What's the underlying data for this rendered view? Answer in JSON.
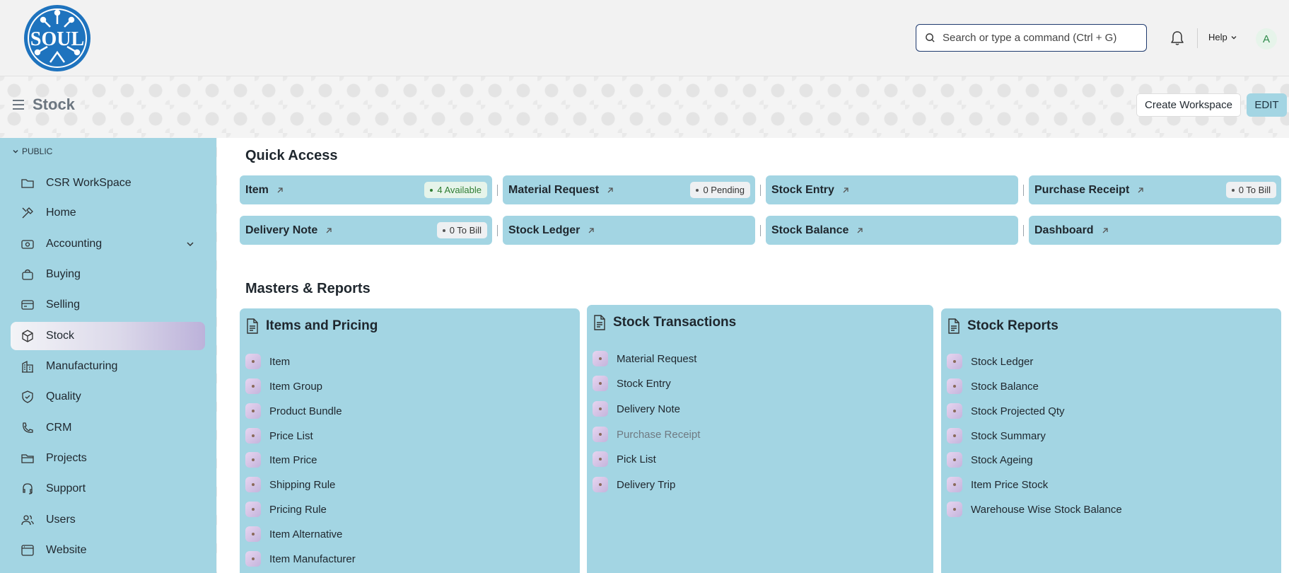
{
  "app": {
    "logo_text": "SOUL"
  },
  "topbar": {
    "search_placeholder": "Search or type a command (Ctrl + G)",
    "help_label": "Help",
    "avatar_initial": "A"
  },
  "page": {
    "title": "Stock",
    "create_workspace_label": "Create Workspace",
    "edit_label": "EDIT"
  },
  "sidebar": {
    "section_label": "PUBLIC",
    "items": [
      {
        "label": "CSR WorkSpace",
        "icon": "folder-icon"
      },
      {
        "label": "Home",
        "icon": "tools-icon"
      },
      {
        "label": "Accounting",
        "icon": "money-icon"
      },
      {
        "label": "Buying",
        "icon": "bag-icon"
      },
      {
        "label": "Selling",
        "icon": "card-icon"
      },
      {
        "label": "Stock",
        "icon": "box-icon"
      },
      {
        "label": "Manufacturing",
        "icon": "building-icon"
      },
      {
        "label": "Quality",
        "icon": "shield-icon"
      },
      {
        "label": "CRM",
        "icon": "phone-icon"
      },
      {
        "label": "Projects",
        "icon": "folder-icon"
      },
      {
        "label": "Support",
        "icon": "headset-icon"
      },
      {
        "label": "Users",
        "icon": "users-icon"
      },
      {
        "label": "Website",
        "icon": "browser-icon"
      }
    ]
  },
  "quick_access": {
    "heading": "Quick Access",
    "cards": [
      {
        "label": "Item",
        "badge": "4 Available"
      },
      {
        "label": "Material Request",
        "badge": "0 Pending"
      },
      {
        "label": "Stock Entry",
        "badge": ""
      },
      {
        "label": "Purchase Receipt",
        "badge": "0 To Bill"
      },
      {
        "label": "Delivery Note",
        "badge": "0 To Bill"
      },
      {
        "label": "Stock Ledger",
        "badge": ""
      },
      {
        "label": "Stock Balance",
        "badge": ""
      },
      {
        "label": "Dashboard",
        "badge": ""
      }
    ]
  },
  "masters": {
    "heading": "Masters & Reports",
    "panels": [
      {
        "title": "Items and Pricing",
        "links": [
          "Item",
          "Item Group",
          "Product Bundle",
          "Price List",
          "Item Price",
          "Shipping Rule",
          "Pricing Rule",
          "Item Alternative",
          "Item Manufacturer"
        ]
      },
      {
        "title": "Stock Transactions",
        "links": [
          "Material Request",
          "Stock Entry",
          "Delivery Note",
          "Purchase Receipt",
          "Pick List",
          "Delivery Trip"
        ]
      },
      {
        "title": "Stock Reports",
        "links": [
          "Stock Ledger",
          "Stock Balance",
          "Stock Projected Qty",
          "Stock Summary",
          "Stock Ageing",
          "Item Price Stock",
          "Warehouse Wise Stock Balance"
        ]
      }
    ]
  },
  "colors": {
    "accent": "#a3d5e3",
    "active_gradient_end": "#bcb2da",
    "search_border": "#1f3a6e"
  }
}
